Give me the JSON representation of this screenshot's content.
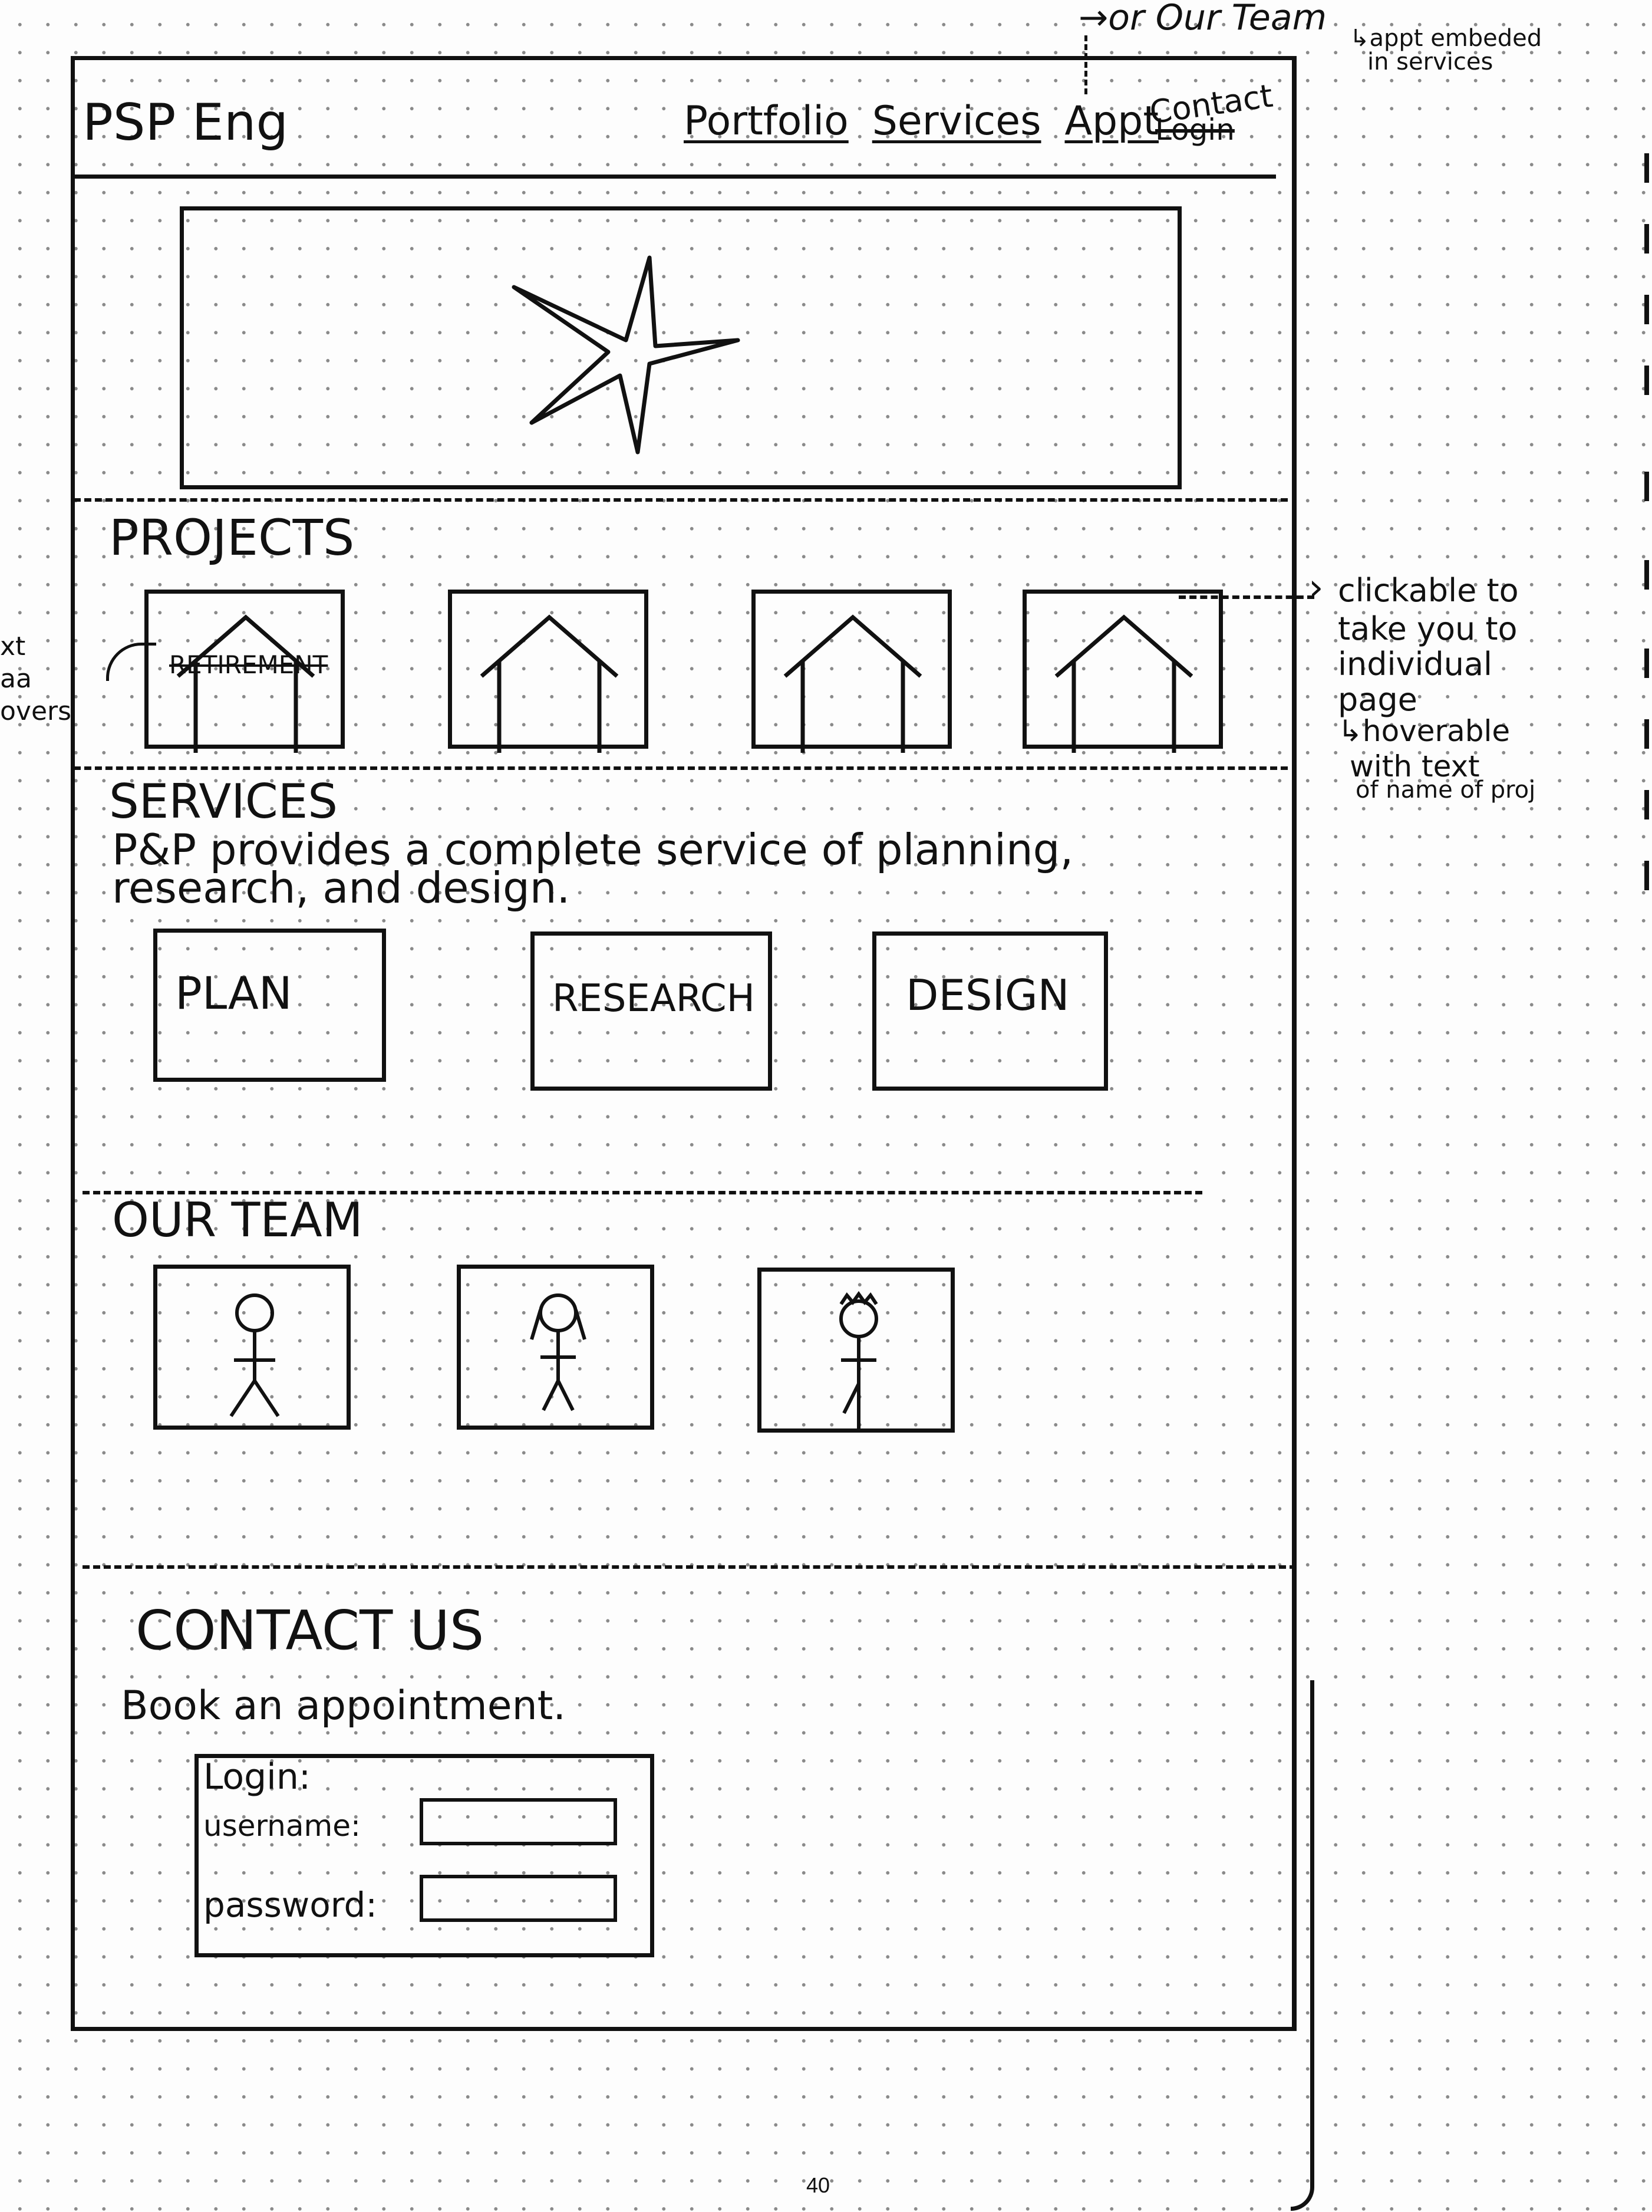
{
  "notes": {
    "top_arrow": "→or Our Team",
    "top_sub_1": "↳appt embeded",
    "top_sub_2": "in services",
    "right_1": "clickable to",
    "right_2": "take you to",
    "right_3": "individual",
    "right_4": "page",
    "right_5": "↳hoverable",
    "right_6": "with text",
    "right_7": "of name of proj",
    "left_1": "xt",
    "left_2": "aa",
    "left_3": "overs"
  },
  "header": {
    "logo": "PSP Eng",
    "nav": [
      "Portfolio",
      "Services",
      "Appt",
      "Contact"
    ],
    "nav_strike": "Login"
  },
  "hero": {
    "icon": "star-icon"
  },
  "projects": {
    "title": "PROJECTS",
    "hover_label": "RETIREMENT",
    "items": 4
  },
  "services": {
    "title": "SERVICES",
    "desc_1": "P&P provides a complete service of planning,",
    "desc_2": "research, and design.",
    "boxes": [
      "PLAN",
      "RESEARCH",
      "DESIGN"
    ]
  },
  "team": {
    "title": "OUR TEAM",
    "members": 3
  },
  "contact": {
    "title": "CONTACT US",
    "subtitle": "Book an appointment.",
    "login_title": "Login:",
    "username_label": "username:",
    "password_label": "password:"
  },
  "page_number": "40"
}
